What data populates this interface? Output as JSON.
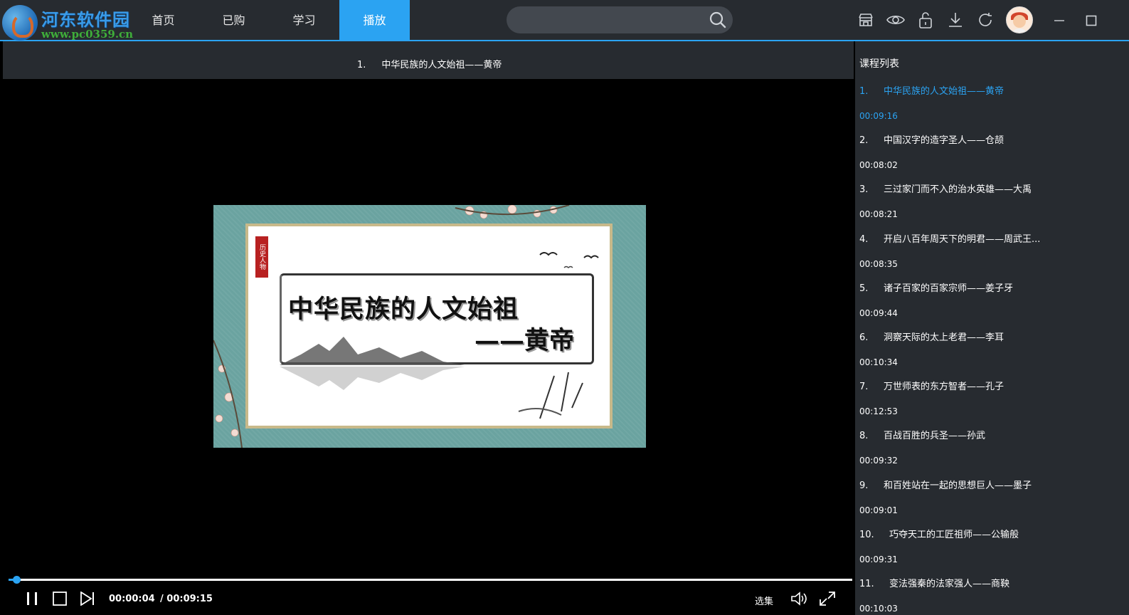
{
  "logo": {
    "text": "河东软件园",
    "url": "www.pc0359.cn"
  },
  "nav": {
    "items": [
      "首页",
      "已购",
      "学习",
      "播放"
    ],
    "active_index": 3
  },
  "search": {
    "placeholder": "",
    "value": ""
  },
  "toolbar_icons": [
    "shop-icon",
    "eye-icon",
    "unlock-icon",
    "download-icon",
    "refresh-icon"
  ],
  "window_controls": [
    "minimize-icon",
    "maximize-icon"
  ],
  "player": {
    "title_number": "1.",
    "title": "中华民族的人文始祖——黄帝",
    "slide": {
      "seal_text": "历史人物",
      "line1": "中华民族的人文始祖",
      "line2": "——黄帝"
    },
    "current_time": "00:00:04",
    "total_time": "/ 00:09:15",
    "progress_fraction": 0.007,
    "select_episode_label": "选集",
    "controls": [
      "pause-icon",
      "stop-icon",
      "next-icon",
      "volume-icon",
      "fullscreen-icon"
    ]
  },
  "course_list": {
    "title": "课程列表",
    "active_index": 0,
    "items": [
      {
        "num": "1.",
        "name": "中华民族的人文始祖——黄帝",
        "duration": "00:09:16"
      },
      {
        "num": "2.",
        "name": "中国汉字的造字圣人——仓颉",
        "duration": "00:08:02"
      },
      {
        "num": "3.",
        "name": "三过家门而不入的治水英雄——大禹",
        "duration": "00:08:21"
      },
      {
        "num": "4.",
        "name": "开启八百年周天下的明君——周武王...",
        "duration": "00:08:35"
      },
      {
        "num": "5.",
        "name": "诸子百家的百家宗师——姜子牙",
        "duration": "00:09:44"
      },
      {
        "num": "6.",
        "name": "洞察天际的太上老君——李耳",
        "duration": "00:10:34"
      },
      {
        "num": "7.",
        "name": "万世师表的东方智者——孔子",
        "duration": "00:12:53"
      },
      {
        "num": "8.",
        "name": "百战百胜的兵圣——孙武",
        "duration": "00:09:32"
      },
      {
        "num": "9.",
        "name": "和百姓站在一起的思想巨人——墨子",
        "duration": "00:09:01"
      },
      {
        "num": "10.",
        "name": "巧夺天工的工匠祖师——公输般",
        "duration": "00:09:31"
      },
      {
        "num": "11.",
        "name": "变法强秦的法家强人——商鞅",
        "duration": "00:10:03"
      }
    ]
  },
  "colors": {
    "accent": "#2ba3f2",
    "bar": "#272b30",
    "player_bg": "#000000"
  }
}
